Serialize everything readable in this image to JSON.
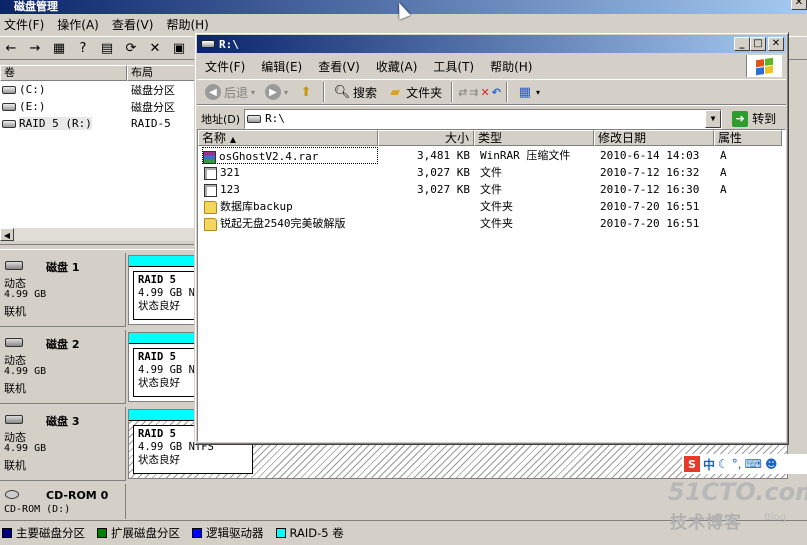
{
  "disk_mgmt": {
    "title": "磁盘管理",
    "menu": [
      "文件(F)",
      "操作(A)",
      "查看(V)",
      "帮助(H)"
    ],
    "volume_headers": {
      "vol": "卷",
      "layout": "布局"
    },
    "volumes": [
      {
        "name": "(C:)",
        "layout": "磁盘分区"
      },
      {
        "name": "(E:)",
        "layout": "磁盘分区"
      },
      {
        "name": "RAID 5 (R:)",
        "layout": "RAID-5"
      }
    ],
    "disks": [
      {
        "name": "磁盘 1",
        "type": "动态",
        "size": "4.99 GB",
        "status": "联机",
        "part_title": "RAID 5",
        "part_size": "4.99 GB N",
        "part_status": "状态良好"
      },
      {
        "name": "磁盘 2",
        "type": "动态",
        "size": "4.99 GB",
        "status": "联机",
        "part_title": "RAID 5",
        "part_size": "4.99 GB N",
        "part_status": "状态良好"
      },
      {
        "name": "磁盘 3",
        "type": "动态",
        "size": "4.99 GB",
        "status": "联机",
        "part_title": "RAID 5",
        "part_size": "4.99 GB NTFS",
        "part_status": "状态良好"
      }
    ],
    "cdrom": {
      "name": "CD-ROM 0",
      "sub": "CD-ROM (D:)"
    },
    "legend": [
      {
        "label": "主要磁盘分区",
        "color": "#000080"
      },
      {
        "label": "扩展磁盘分区",
        "color": "#008000"
      },
      {
        "label": "逻辑驱动器",
        "color": "#0000ff"
      },
      {
        "label": "RAID-5 卷",
        "color": "#00ffff"
      }
    ]
  },
  "explorer": {
    "title": "R:\\",
    "menu": [
      "文件(F)",
      "编辑(E)",
      "查看(V)",
      "收藏(A)",
      "工具(T)",
      "帮助(H)"
    ],
    "toolbar": {
      "back": "后退",
      "search": "搜索",
      "folders": "文件夹"
    },
    "address_label": "地址(D)",
    "address_value": "R:\\",
    "goto_label": "转到",
    "columns": {
      "name": "名称",
      "size": "大小",
      "type": "类型",
      "modified": "修改日期",
      "attr": "属性"
    },
    "files": [
      {
        "name": "osGhostV2.4.rar",
        "size": "3,481 KB",
        "type": "WinRAR 压缩文件",
        "modified": "2010-6-14 14:03",
        "attr": "A",
        "icon": "rar"
      },
      {
        "name": "321",
        "size": "3,027 KB",
        "type": "文件",
        "modified": "2010-7-12 16:32",
        "attr": "A",
        "icon": "file"
      },
      {
        "name": "123",
        "size": "3,027 KB",
        "type": "文件",
        "modified": "2010-7-12 16:30",
        "attr": "A",
        "icon": "file"
      },
      {
        "name": "数据库backup",
        "size": "",
        "type": "文件夹",
        "modified": "2010-7-20 16:51",
        "attr": "",
        "icon": "folder"
      },
      {
        "name": "锐起无盘2540完美破解版",
        "size": "",
        "type": "文件夹",
        "modified": "2010-7-20 16:51",
        "attr": "",
        "icon": "folder"
      }
    ]
  },
  "overlay": {
    "ime_s": "S",
    "ime_zh": "中",
    "watermark": "51CTO.com",
    "watermark_sub": "技术博客",
    "watermark_blog": "Blog"
  }
}
